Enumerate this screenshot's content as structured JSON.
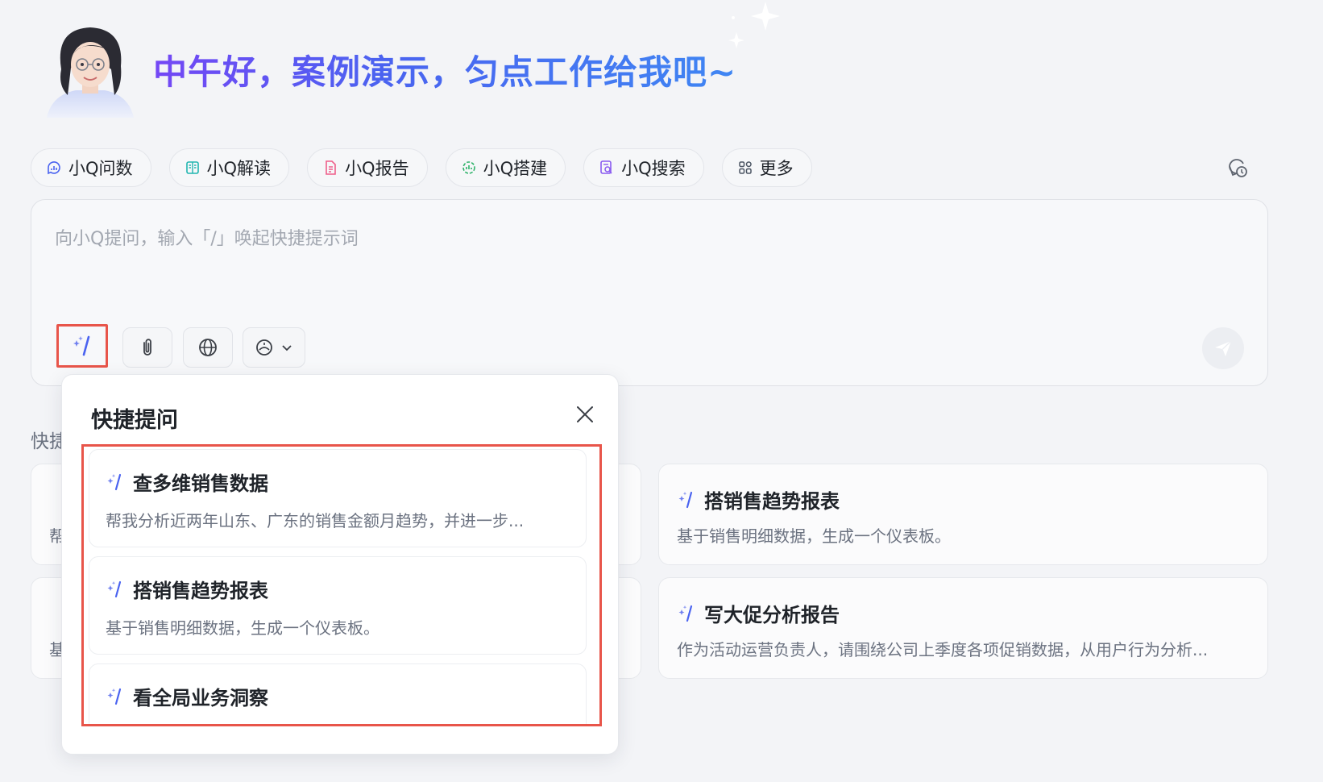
{
  "header": {
    "greeting": "中午好，案例演示，匀点工作给我吧~"
  },
  "chips": [
    {
      "label": "小Q问数",
      "icon": "chat-data-icon"
    },
    {
      "label": "小Q解读",
      "icon": "read-icon"
    },
    {
      "label": "小Q报告",
      "icon": "report-icon"
    },
    {
      "label": "小Q搭建",
      "icon": "build-icon"
    },
    {
      "label": "小Q搜索",
      "icon": "search-doc-icon"
    },
    {
      "label": "更多",
      "icon": "grid-icon"
    }
  ],
  "input": {
    "placeholder": "向小Q提问，输入「/」唤起快捷提示词"
  },
  "quick_section": {
    "label_partial": "快捷",
    "left_desc_partial_1": "帮",
    "left_desc_partial_2": "基",
    "cards_right": [
      {
        "title": "搭销售趋势报表",
        "desc": "基于销售明细数据，生成一个仪表板。"
      },
      {
        "title": "写大促分析报告",
        "desc": "作为活动运营负责人，请围绕公司上季度各项促销数据，从用户行为分析..."
      }
    ]
  },
  "popup": {
    "title": "快捷提问",
    "items": [
      {
        "title": "查多维销售数据",
        "desc": "帮我分析近两年山东、广东的销售金额月趋势，并进一步..."
      },
      {
        "title": "搭销售趋势报表",
        "desc": "基于销售明细数据，生成一个仪表板。"
      },
      {
        "title": "看全局业务洞察",
        "desc": ""
      }
    ]
  },
  "colors": {
    "accent": "#4a63f0",
    "highlight_border": "#e8554a",
    "background": "#f3f4f7"
  }
}
